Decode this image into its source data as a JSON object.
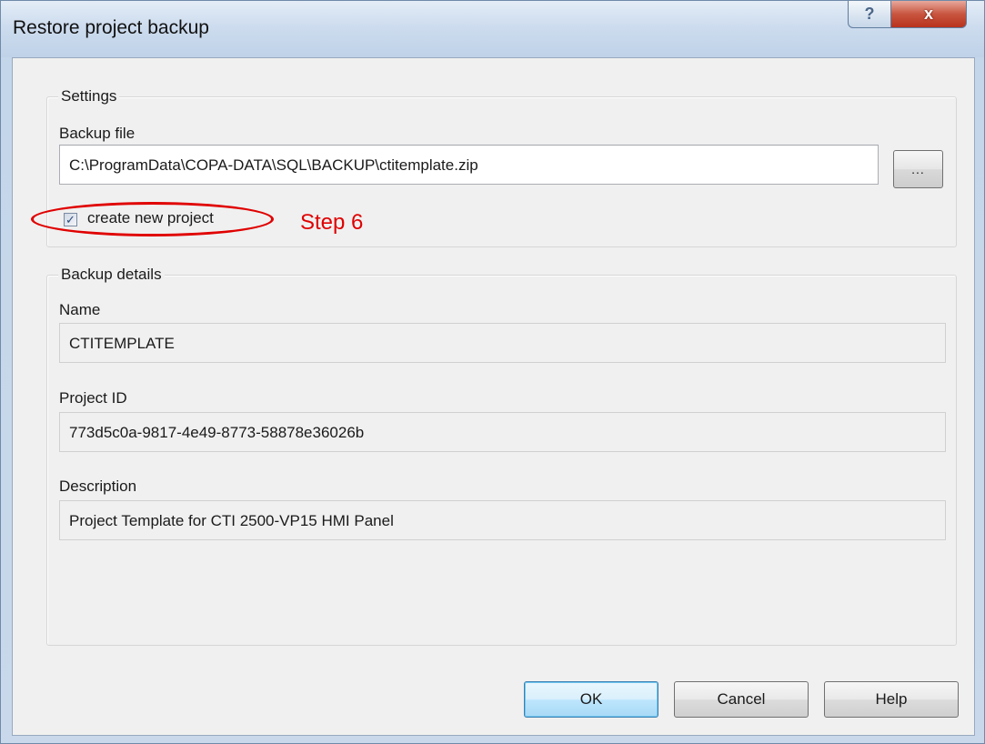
{
  "window": {
    "title": "Restore project backup",
    "help_glyph": "?",
    "close_glyph": "x"
  },
  "settings": {
    "group_label": "Settings",
    "backup_file_label": "Backup file",
    "backup_file_value": "C:\\ProgramData\\COPA-DATA\\SQL\\BACKUP\\ctitemplate.zip",
    "browse_label": "...",
    "create_new_project_label": "create new project",
    "create_new_project_checked": true
  },
  "annotation": {
    "text": "Step 6",
    "color": "#e00000"
  },
  "details": {
    "group_label": "Backup details",
    "name_label": "Name",
    "name_value": "CTITEMPLATE",
    "project_id_label": "Project ID",
    "project_id_value": "773d5c0a-9817-4e49-8773-58878e36026b",
    "description_label": "Description",
    "description_value": "Project Template for CTI 2500-VP15 HMI Panel"
  },
  "buttons": {
    "ok": "OK",
    "cancel": "Cancel",
    "help": "Help"
  }
}
